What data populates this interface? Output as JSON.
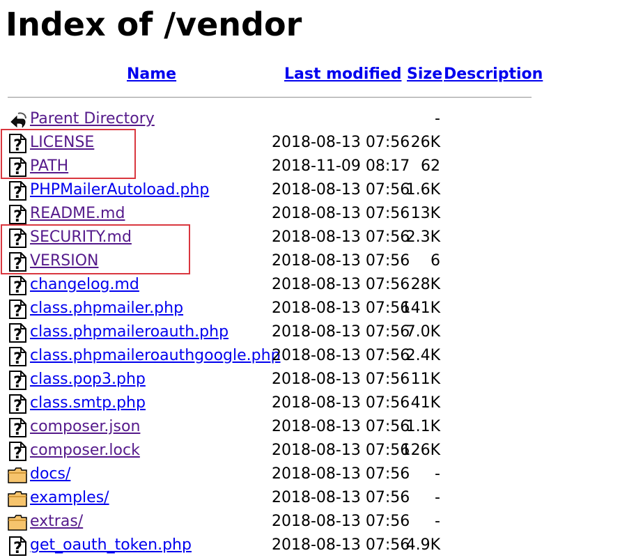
{
  "page": {
    "title": "Index of /vendor"
  },
  "table": {
    "headers": {
      "name": "Name",
      "last_modified": "Last modified",
      "size": "Size",
      "description": "Description"
    },
    "rows": [
      {
        "name": "Parent Directory",
        "date": "",
        "size": "-",
        "icon": "back-icon",
        "visited": true
      },
      {
        "name": "LICENSE",
        "date": "2018-08-13 07:56",
        "size": "26K",
        "icon": "unknown-file-icon",
        "visited": true
      },
      {
        "name": "PATH",
        "date": "2018-11-09 08:17",
        "size": "62",
        "icon": "unknown-file-icon",
        "visited": true
      },
      {
        "name": "PHPMailerAutoload.php",
        "date": "2018-08-13 07:56",
        "size": "1.6K",
        "icon": "unknown-file-icon",
        "visited": false
      },
      {
        "name": "README.md",
        "date": "2018-08-13 07:56",
        "size": "13K",
        "icon": "unknown-file-icon",
        "visited": true
      },
      {
        "name": "SECURITY.md",
        "date": "2018-08-13 07:56",
        "size": "2.3K",
        "icon": "unknown-file-icon",
        "visited": true
      },
      {
        "name": "VERSION",
        "date": "2018-08-13 07:56",
        "size": "6",
        "icon": "unknown-file-icon",
        "visited": true
      },
      {
        "name": "changelog.md",
        "date": "2018-08-13 07:56",
        "size": "28K",
        "icon": "unknown-file-icon",
        "visited": false
      },
      {
        "name": "class.phpmailer.php",
        "date": "2018-08-13 07:56",
        "size": "141K",
        "icon": "unknown-file-icon",
        "visited": false
      },
      {
        "name": "class.phpmaileroauth.php",
        "date": "2018-08-13 07:56",
        "size": "7.0K",
        "icon": "unknown-file-icon",
        "visited": false
      },
      {
        "name": "class.phpmaileroauthgoogle.php",
        "date": "2018-08-13 07:56",
        "size": "2.4K",
        "icon": "unknown-file-icon",
        "visited": false
      },
      {
        "name": "class.pop3.php",
        "date": "2018-08-13 07:56",
        "size": "11K",
        "icon": "unknown-file-icon",
        "visited": false
      },
      {
        "name": "class.smtp.php",
        "date": "2018-08-13 07:56",
        "size": "41K",
        "icon": "unknown-file-icon",
        "visited": false
      },
      {
        "name": "composer.json",
        "date": "2018-08-13 07:56",
        "size": "1.1K",
        "icon": "unknown-file-icon",
        "visited": true
      },
      {
        "name": "composer.lock",
        "date": "2018-08-13 07:56",
        "size": "126K",
        "icon": "unknown-file-icon",
        "visited": true
      },
      {
        "name": "docs/",
        "date": "2018-08-13 07:56",
        "size": "-",
        "icon": "folder-icon",
        "visited": false
      },
      {
        "name": "examples/",
        "date": "2018-08-13 07:56",
        "size": "-",
        "icon": "folder-icon",
        "visited": false
      },
      {
        "name": "extras/",
        "date": "2018-08-13 07:56",
        "size": "-",
        "icon": "folder-icon",
        "visited": true
      },
      {
        "name": "get_oauth_token.php",
        "date": "2018-08-13 07:56",
        "size": "4.9K",
        "icon": "unknown-file-icon",
        "visited": false
      }
    ]
  },
  "colors": {
    "link": "#0000ee",
    "visited": "#551a8b",
    "highlight": "#d9363e"
  }
}
